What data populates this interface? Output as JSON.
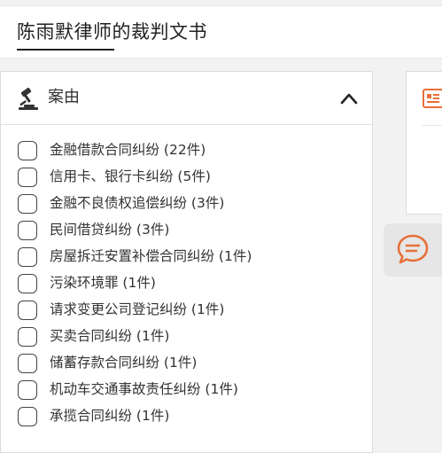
{
  "header": {
    "title": "陈雨默律师的裁判文书"
  },
  "filter_panel": {
    "title": "案由",
    "icon": "gavel-icon",
    "collapse_icon": "chevron-up-icon",
    "items": [
      {
        "label": "金融借款合同纠纷 (22件)",
        "checked": false
      },
      {
        "label": "信用卡、银行卡纠纷 (5件)",
        "checked": false
      },
      {
        "label": "金融不良债权追偿纠纷 (3件)",
        "checked": false
      },
      {
        "label": "民间借贷纠纷 (3件)",
        "checked": false
      },
      {
        "label": "房屋拆迁安置补偿合同纠纷 (1件)",
        "checked": false
      },
      {
        "label": "污染环境罪 (1件)",
        "checked": false
      },
      {
        "label": "请求变更公司登记纠纷 (1件)",
        "checked": false
      },
      {
        "label": "买卖合同纠纷 (1件)",
        "checked": false
      },
      {
        "label": "储蓄存款合同纠纷 (1件)",
        "checked": false
      },
      {
        "label": "机动车交通事故责任纠纷 (1件)",
        "checked": false
      },
      {
        "label": "承揽合同纠纷 (1件)",
        "checked": false
      }
    ]
  },
  "side": {
    "doc_icon": "document-icon",
    "chat_icon": "chat-bubble-icon"
  },
  "colors": {
    "accent": "#e8703a",
    "text": "#333333",
    "background": "#f2f2f2"
  }
}
